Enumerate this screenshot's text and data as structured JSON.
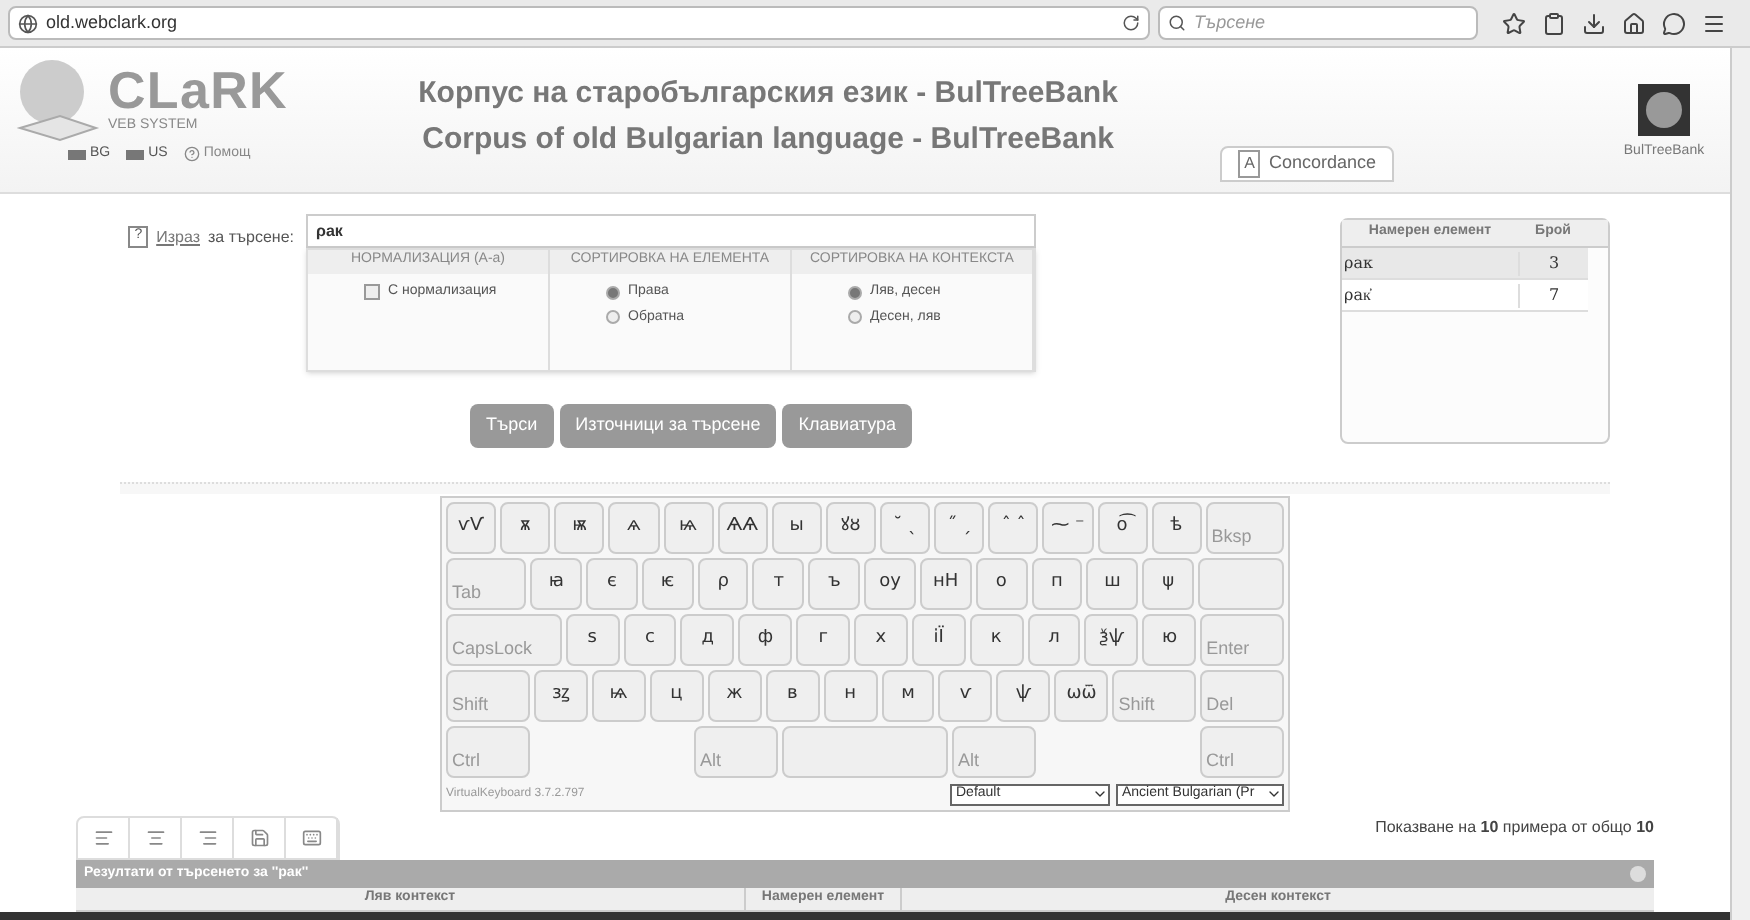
{
  "browser": {
    "url": "old.webclark.org",
    "search_placeholder": "Търсене"
  },
  "header": {
    "logo": "CLaRK",
    "logo_sub": "VEB SYSTEM",
    "title_bg": "Корпус на старобългарския език - BulTreeBank",
    "title_en": "Corpus of old Bulgarian language - BulTreeBank",
    "langs": [
      {
        "label": "BG"
      },
      {
        "label": "US"
      }
    ],
    "help": "Помощ",
    "concordance_icon": "A",
    "concordance": "Concordance",
    "partner": "BulTreeBank"
  },
  "search": {
    "help": "?",
    "link": "Израз",
    "label": "за търсене:",
    "value": "ρак",
    "columns": [
      "НОРМАЛИЗАЦИЯ (А-а)",
      "СОРТИРОВКА НА ЕЛЕМЕНТА",
      "СОРТИРОВКА НА КОНТЕКСТА"
    ],
    "normalize": {
      "label": "С нормализация",
      "checked": false
    },
    "element_sort": [
      {
        "label": "Права",
        "selected": true
      },
      {
        "label": "Обратна",
        "selected": false
      }
    ],
    "context_sort": [
      {
        "label": "Ляв, десен",
        "selected": true
      },
      {
        "label": "Десен, ляв",
        "selected": false
      }
    ],
    "buttons": [
      "Търси",
      "Източници за търсене",
      "Клавиатура"
    ]
  },
  "found": {
    "columns": [
      "Намерен елемент",
      "Брой"
    ],
    "rows": [
      {
        "element": "ρак",
        "count": "3",
        "selected": true
      },
      {
        "element": "ρак҆",
        "count": "7",
        "selected": false
      }
    ]
  },
  "keyboard": {
    "rows": [
      {
        "keys": [
          {
            "label": "ѵѴ",
            "kind": "char"
          },
          {
            "label": "ѫ",
            "kind": "char"
          },
          {
            "label": "ѭ",
            "kind": "char"
          },
          {
            "label": "ѧ",
            "kind": "char"
          },
          {
            "label": "ѩ",
            "kind": "char"
          },
          {
            "label": "ѦѦ",
            "kind": "char"
          },
          {
            "label": "ы",
            "kind": "char"
          },
          {
            "label": "ꙋȣ",
            "kind": "char"
          },
          {
            "label": "˘ ˎ",
            "kind": "char"
          },
          {
            "label": "˝ ˏ",
            "kind": "char"
          },
          {
            "label": "ˆ ˆ",
            "kind": "char"
          },
          {
            "label": "⁓ ⁻",
            "kind": "char"
          },
          {
            "label": "о͡",
            "kind": "char"
          },
          {
            "label": "ѣ",
            "kind": "char"
          },
          {
            "label": "Bksp",
            "kind": "func"
          }
        ]
      },
      {
        "keys": [
          {
            "label": "Tab",
            "kind": "func"
          },
          {
            "label": "ꙗ",
            "kind": "char"
          },
          {
            "label": "є",
            "kind": "char"
          },
          {
            "label": "ѥ",
            "kind": "char"
          },
          {
            "label": "ρ",
            "kind": "char"
          },
          {
            "label": "т",
            "kind": "char"
          },
          {
            "label": "ъ",
            "kind": "char"
          },
          {
            "label": "оу",
            "kind": "char"
          },
          {
            "label": "нН",
            "kind": "char"
          },
          {
            "label": "о",
            "kind": "char"
          },
          {
            "label": "п",
            "kind": "char"
          },
          {
            "label": "ш",
            "kind": "char"
          },
          {
            "label": "ψ",
            "kind": "char"
          },
          {
            "kind": "wide"
          }
        ]
      },
      {
        "keys": [
          {
            "label": "CapsLock",
            "kind": "func"
          },
          {
            "label": "ѕ",
            "kind": "char"
          },
          {
            "label": "с",
            "kind": "char"
          },
          {
            "label": "д",
            "kind": "char"
          },
          {
            "label": "ф",
            "kind": "char"
          },
          {
            "label": "г",
            "kind": "char"
          },
          {
            "label": "х",
            "kind": "char"
          },
          {
            "label": "іЇ",
            "kind": "char"
          },
          {
            "label": "к",
            "kind": "char"
          },
          {
            "label": "л",
            "kind": "char"
          },
          {
            "label": "ѯѱ",
            "kind": "char"
          },
          {
            "label": "ю",
            "kind": "char"
          },
          {
            "label": "Enter",
            "kind": "func"
          }
        ]
      },
      {
        "keys": [
          {
            "label": "Shift",
            "kind": "func"
          },
          {
            "label": "зꙁ",
            "kind": "char"
          },
          {
            "label": "ѩ",
            "kind": "char"
          },
          {
            "label": "ц",
            "kind": "char"
          },
          {
            "label": "ж",
            "kind": "char"
          },
          {
            "label": "в",
            "kind": "char"
          },
          {
            "label": "н",
            "kind": "char"
          },
          {
            "label": "м",
            "kind": "char"
          },
          {
            "label": "ѵ",
            "kind": "char"
          },
          {
            "label": "ѱ",
            "kind": "char"
          },
          {
            "label": "ѡѿ",
            "kind": "char"
          },
          {
            "label": "Shift",
            "kind": "func"
          },
          {
            "label": "Del",
            "kind": "func"
          }
        ]
      },
      {
        "keys": [
          {
            "label": "Ctrl",
            "kind": "func"
          },
          {
            "kind": "gap"
          },
          {
            "label": "Alt",
            "kind": "func"
          },
          {
            "kind": "space"
          },
          {
            "label": "Alt",
            "kind": "func"
          },
          {
            "kind": "gap"
          },
          {
            "label": "Ctrl",
            "kind": "func"
          }
        ]
      }
    ],
    "version": "VirtualKeyboard 3.7.2.797",
    "layout": "Default",
    "language": "Ancient Bulgarian (Pr"
  },
  "results": {
    "summary": "Показване на **10** примера от общо **10**",
    "title": "Резултати от търсенето за ''рак''",
    "columns": [
      "Ляв контекст",
      "Намерен елемент",
      "Десен контекст"
    ]
  }
}
